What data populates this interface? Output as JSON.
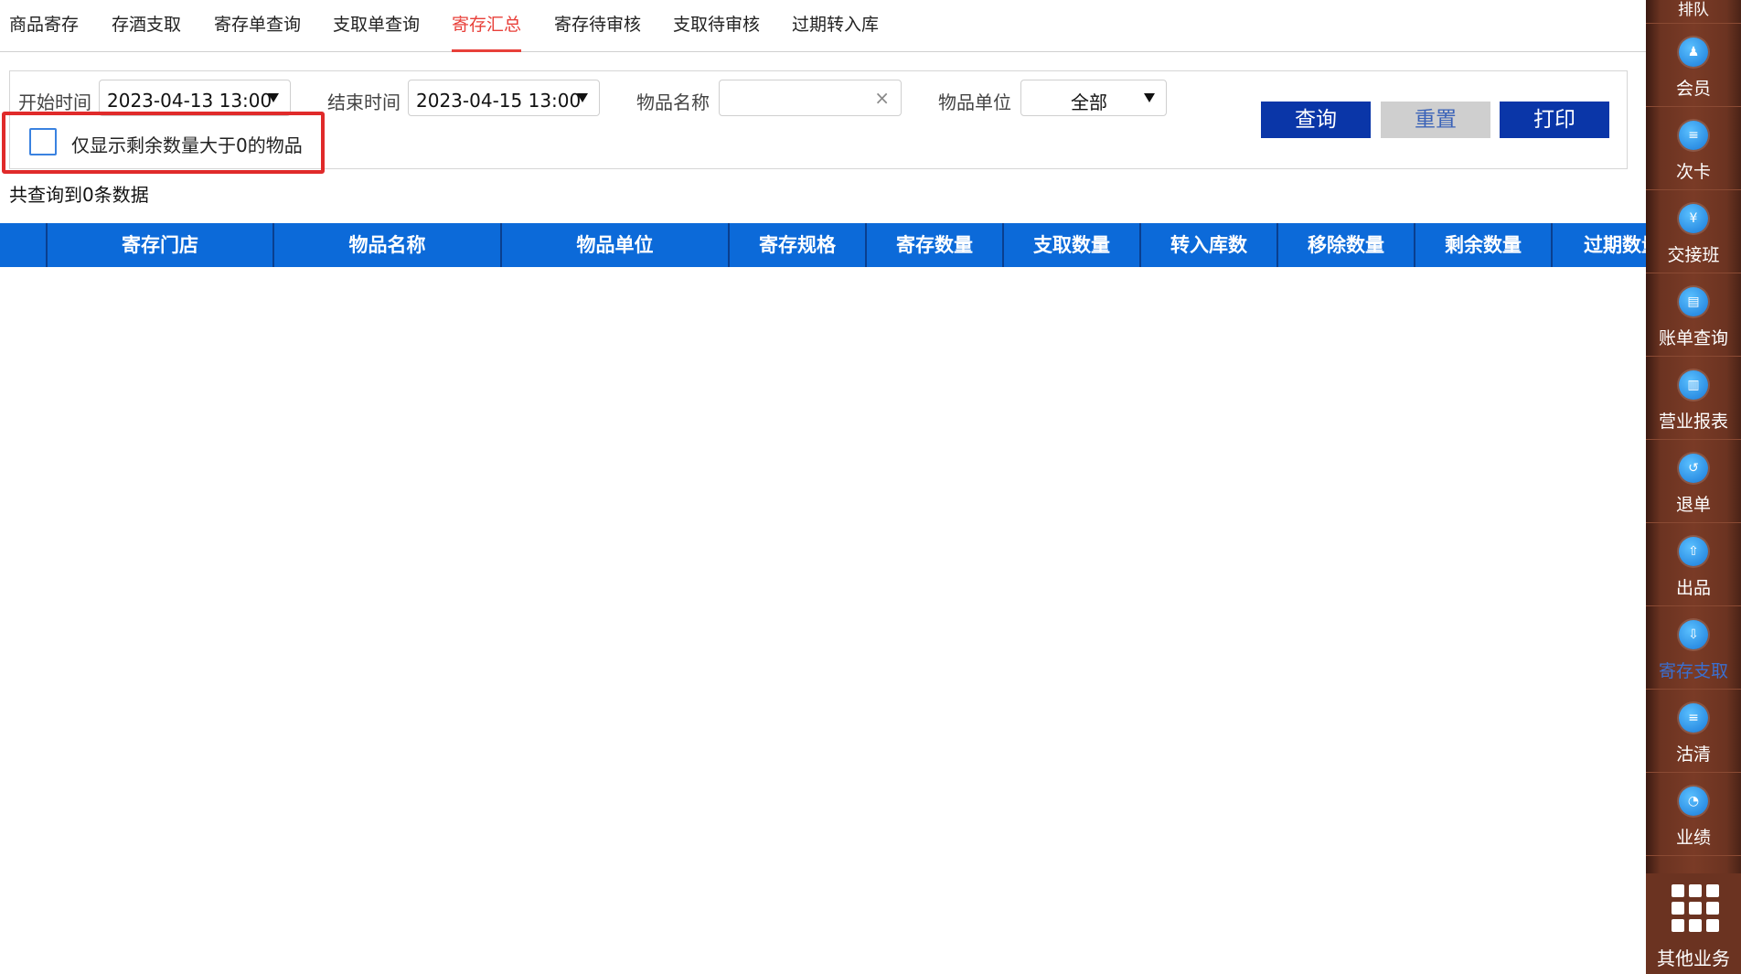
{
  "tabs": [
    {
      "label": "商品寄存"
    },
    {
      "label": "存酒支取"
    },
    {
      "label": "寄存单查询"
    },
    {
      "label": "支取单查询"
    },
    {
      "label": "寄存汇总"
    },
    {
      "label": "寄存待审核"
    },
    {
      "label": "支取待审核"
    },
    {
      "label": "过期转入库"
    }
  ],
  "active_tab": "寄存汇总",
  "filters": {
    "start_time_label": "开始时间",
    "start_time_value": "2023-04-13 13:00",
    "end_time_label": "结束时间",
    "end_time_value": "2023-04-15 13:00",
    "item_name_label": "物品名称",
    "item_name_value": "",
    "clear_symbol": "×",
    "item_unit_label": "物品单位",
    "item_unit_value": "全部",
    "only_remaining_label": "仅显示剩余数量大于0的物品",
    "only_remaining_checked": false
  },
  "buttons": {
    "query": "查询",
    "reset": "重置",
    "print": "打印"
  },
  "result_count_text": "共查询到0条数据",
  "table": {
    "columns": [
      "",
      "寄存门店",
      "物品名称",
      "物品单位",
      "寄存规格",
      "寄存数量",
      "支取数量",
      "转入库数",
      "移除数量",
      "剩余数量",
      "过期数量"
    ],
    "rows": []
  },
  "sidebar": {
    "top_partial_label": "排队",
    "items": [
      {
        "label": "会员",
        "icon": "member-icon",
        "glyph": "♟"
      },
      {
        "label": "次卡",
        "icon": "count-card-icon",
        "glyph": "≡"
      },
      {
        "label": "交接班",
        "icon": "shift-icon",
        "glyph": "¥"
      },
      {
        "label": "账单查询",
        "icon": "bill-search-icon",
        "glyph": "▤"
      },
      {
        "label": "营业报表",
        "icon": "report-icon",
        "glyph": "▥"
      },
      {
        "label": "退单",
        "icon": "refund-icon",
        "glyph": "↺"
      },
      {
        "label": "出品",
        "icon": "output-icon",
        "glyph": "⇧"
      },
      {
        "label": "寄存支取",
        "icon": "deposit-withdraw-icon",
        "glyph": "⇩"
      },
      {
        "label": "沽清",
        "icon": "sold-out-icon",
        "glyph": "≡"
      },
      {
        "label": "业绩",
        "icon": "performance-icon",
        "glyph": "◔"
      }
    ],
    "active_item": "寄存支取",
    "more_label": "其他业务"
  },
  "colors": {
    "accent_red": "#e8403a",
    "table_header_blue": "#0c6ad9",
    "button_blue": "#0a36a8",
    "highlight_red": "#e02a2a"
  }
}
